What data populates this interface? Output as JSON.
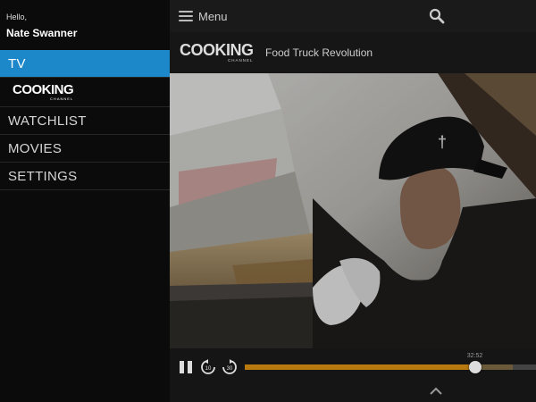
{
  "sidebar": {
    "greeting": "Hello,",
    "username": "Nate Swanner",
    "items": [
      {
        "label": "TV",
        "active": true
      },
      {
        "label": "WATCHLIST"
      },
      {
        "label": "MOVIES"
      },
      {
        "label": "SETTINGS"
      }
    ],
    "channel_logo": {
      "word": "COOKING",
      "sub": "CHANNEL"
    }
  },
  "header": {
    "menu_label": "Menu",
    "search_icon": "search-icon"
  },
  "show": {
    "channel_logo": {
      "word": "COOKING",
      "sub": "CHANNEL"
    },
    "title": "Food Truck Revolution"
  },
  "player": {
    "time_label": "32:52",
    "progress": 0.79,
    "buffered": 0.92,
    "icons": [
      "pause-icon",
      "rewind-icon",
      "forward-icon",
      "chevron-up-icon"
    ]
  },
  "colors": {
    "accent": "#1c87c9",
    "progress": "#b8790f"
  }
}
